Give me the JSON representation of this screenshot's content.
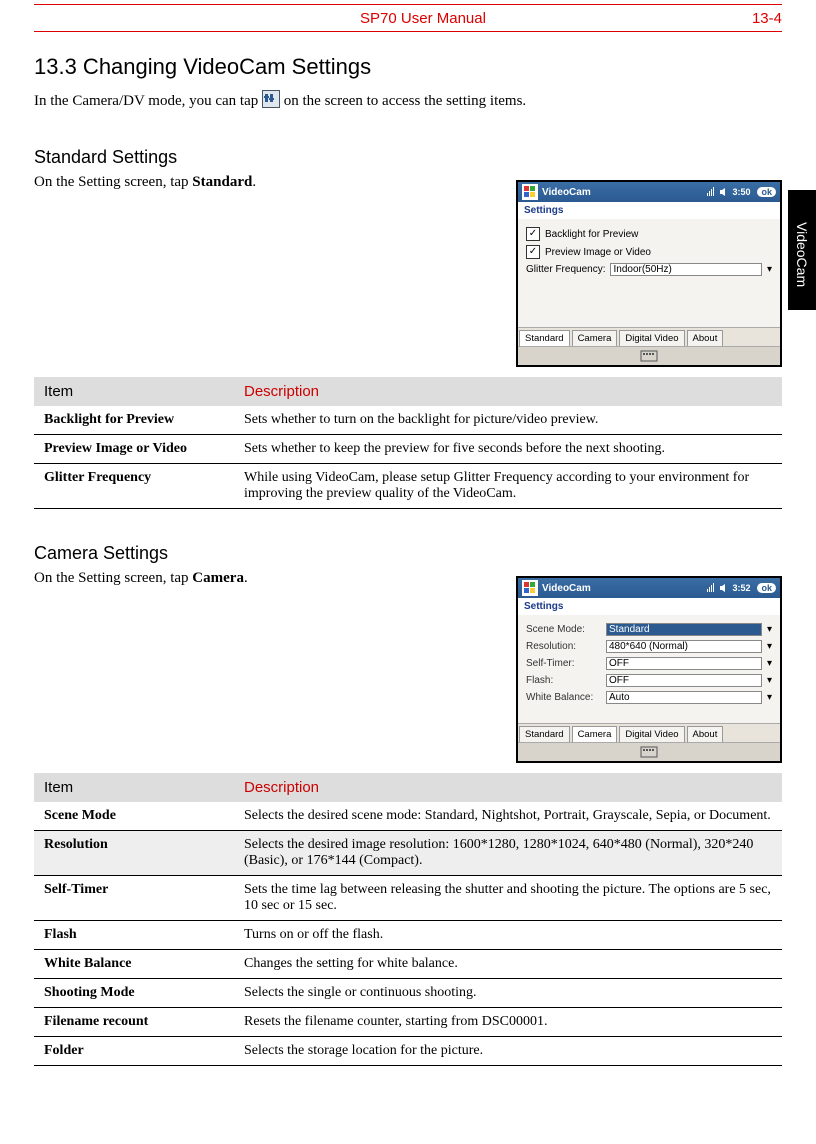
{
  "header": {
    "title": "SP70 User Manual",
    "page": "13-4"
  },
  "side_tab": "VideoCam",
  "section_heading": "13.3    Changing VideoCam Settings",
  "intro_prefix": "In the Camera/DV mode, you can tap  ",
  "intro_suffix": " on the screen to access the setting items.",
  "standard": {
    "heading": "Standard Settings",
    "instruction_prefix": "On the Setting screen, tap ",
    "instruction_bold": "Standard",
    "instruction_suffix": ".",
    "shot": {
      "title": "VideoCam",
      "time": "3:50",
      "ok": "ok",
      "subhead": "Settings",
      "field1_label": "Backlight for Preview",
      "field2_label": "Preview Image or Video",
      "field3_label": "Glitter Frequency:",
      "field3_value": "Indoor(50Hz)",
      "tabs": [
        "Standard",
        "Camera",
        "Digital Video",
        "About"
      ],
      "active_tab": 0
    },
    "table": {
      "item_head": "Item",
      "desc_head": "Description",
      "rows": [
        {
          "item": "Backlight for Preview",
          "desc": "Sets whether to turn on the backlight for picture/video preview."
        },
        {
          "item": "Preview Image or Video",
          "desc": "Sets whether to keep the preview for five seconds before the next shooting."
        },
        {
          "item": "Glitter Frequency",
          "desc": "While using VideoCam, please setup Glitter Frequency according to your environment for improving the preview quality of the VideoCam."
        }
      ]
    }
  },
  "camera": {
    "heading": "Camera Settings",
    "instruction_prefix": "On the Setting screen, tap ",
    "instruction_bold": "Camera",
    "instruction_suffix": ".",
    "shot": {
      "title": "VideoCam",
      "time": "3:52",
      "ok": "ok",
      "subhead": "Settings",
      "rows": [
        {
          "label": "Scene Mode:",
          "value": "Standard",
          "highlight": true
        },
        {
          "label": "Resolution:",
          "value": "480*640 (Normal)"
        },
        {
          "label": "Self-Timer:",
          "value": "OFF"
        },
        {
          "label": "Flash:",
          "value": "OFF"
        },
        {
          "label": "White Balance:",
          "value": "Auto"
        }
      ],
      "tabs": [
        "Standard",
        "Camera",
        "Digital Video",
        "About"
      ],
      "active_tab": 1
    },
    "table": {
      "item_head": "Item",
      "desc_head": "Description",
      "rows": [
        {
          "item": "Scene Mode",
          "desc": "Selects the desired scene mode: Standard, Nightshot, Portrait, Grayscale, Sepia, or Document."
        },
        {
          "item": "Resolution",
          "desc": "Selects the desired image resolution: 1600*1280, 1280*1024, 640*480 (Normal), 320*240 (Basic), or 176*144 (Compact).",
          "alt": true
        },
        {
          "item": "Self-Timer",
          "desc": "Sets the time lag between releasing the shutter and shooting the picture. The options are 5 sec, 10 sec or 15 sec."
        },
        {
          "item": "Flash",
          "desc": "Turns on or off the flash."
        },
        {
          "item": "White Balance",
          "desc": "Changes the setting for white balance."
        },
        {
          "item": "Shooting Mode",
          "desc": "Selects the single or continuous shooting."
        },
        {
          "item": "Filename recount",
          "desc": "Resets the filename counter, starting from DSC00001."
        },
        {
          "item": "Folder",
          "desc": "Selects the storage location for the picture."
        }
      ]
    }
  }
}
